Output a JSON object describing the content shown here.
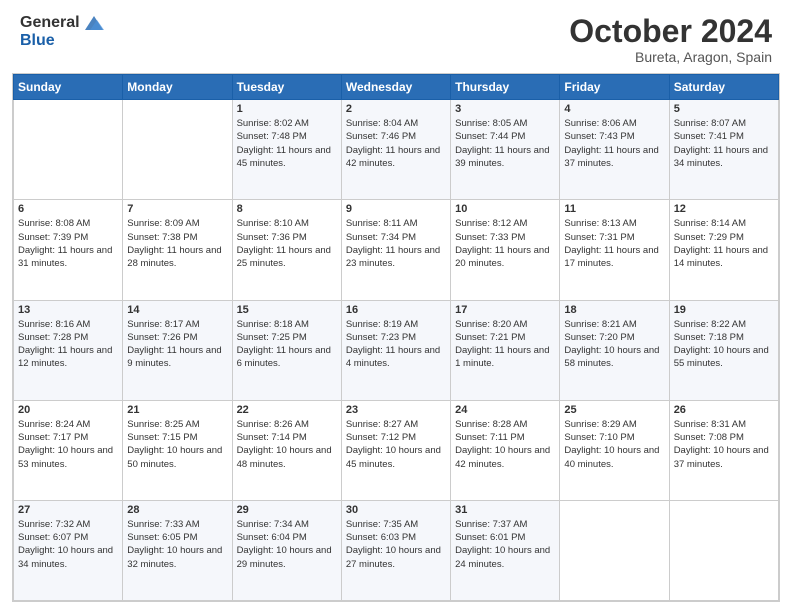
{
  "logo": {
    "general": "General",
    "blue": "Blue"
  },
  "header": {
    "month": "October 2024",
    "location": "Bureta, Aragon, Spain"
  },
  "days_of_week": [
    "Sunday",
    "Monday",
    "Tuesday",
    "Wednesday",
    "Thursday",
    "Friday",
    "Saturday"
  ],
  "weeks": [
    [
      {
        "day": "",
        "info": ""
      },
      {
        "day": "",
        "info": ""
      },
      {
        "day": "1",
        "sunrise": "Sunrise: 8:02 AM",
        "sunset": "Sunset: 7:48 PM",
        "daylight": "Daylight: 11 hours and 45 minutes."
      },
      {
        "day": "2",
        "sunrise": "Sunrise: 8:04 AM",
        "sunset": "Sunset: 7:46 PM",
        "daylight": "Daylight: 11 hours and 42 minutes."
      },
      {
        "day": "3",
        "sunrise": "Sunrise: 8:05 AM",
        "sunset": "Sunset: 7:44 PM",
        "daylight": "Daylight: 11 hours and 39 minutes."
      },
      {
        "day": "4",
        "sunrise": "Sunrise: 8:06 AM",
        "sunset": "Sunset: 7:43 PM",
        "daylight": "Daylight: 11 hours and 37 minutes."
      },
      {
        "day": "5",
        "sunrise": "Sunrise: 8:07 AM",
        "sunset": "Sunset: 7:41 PM",
        "daylight": "Daylight: 11 hours and 34 minutes."
      }
    ],
    [
      {
        "day": "6",
        "sunrise": "Sunrise: 8:08 AM",
        "sunset": "Sunset: 7:39 PM",
        "daylight": "Daylight: 11 hours and 31 minutes."
      },
      {
        "day": "7",
        "sunrise": "Sunrise: 8:09 AM",
        "sunset": "Sunset: 7:38 PM",
        "daylight": "Daylight: 11 hours and 28 minutes."
      },
      {
        "day": "8",
        "sunrise": "Sunrise: 8:10 AM",
        "sunset": "Sunset: 7:36 PM",
        "daylight": "Daylight: 11 hours and 25 minutes."
      },
      {
        "day": "9",
        "sunrise": "Sunrise: 8:11 AM",
        "sunset": "Sunset: 7:34 PM",
        "daylight": "Daylight: 11 hours and 23 minutes."
      },
      {
        "day": "10",
        "sunrise": "Sunrise: 8:12 AM",
        "sunset": "Sunset: 7:33 PM",
        "daylight": "Daylight: 11 hours and 20 minutes."
      },
      {
        "day": "11",
        "sunrise": "Sunrise: 8:13 AM",
        "sunset": "Sunset: 7:31 PM",
        "daylight": "Daylight: 11 hours and 17 minutes."
      },
      {
        "day": "12",
        "sunrise": "Sunrise: 8:14 AM",
        "sunset": "Sunset: 7:29 PM",
        "daylight": "Daylight: 11 hours and 14 minutes."
      }
    ],
    [
      {
        "day": "13",
        "sunrise": "Sunrise: 8:16 AM",
        "sunset": "Sunset: 7:28 PM",
        "daylight": "Daylight: 11 hours and 12 minutes."
      },
      {
        "day": "14",
        "sunrise": "Sunrise: 8:17 AM",
        "sunset": "Sunset: 7:26 PM",
        "daylight": "Daylight: 11 hours and 9 minutes."
      },
      {
        "day": "15",
        "sunrise": "Sunrise: 8:18 AM",
        "sunset": "Sunset: 7:25 PM",
        "daylight": "Daylight: 11 hours and 6 minutes."
      },
      {
        "day": "16",
        "sunrise": "Sunrise: 8:19 AM",
        "sunset": "Sunset: 7:23 PM",
        "daylight": "Daylight: 11 hours and 4 minutes."
      },
      {
        "day": "17",
        "sunrise": "Sunrise: 8:20 AM",
        "sunset": "Sunset: 7:21 PM",
        "daylight": "Daylight: 11 hours and 1 minute."
      },
      {
        "day": "18",
        "sunrise": "Sunrise: 8:21 AM",
        "sunset": "Sunset: 7:20 PM",
        "daylight": "Daylight: 10 hours and 58 minutes."
      },
      {
        "day": "19",
        "sunrise": "Sunrise: 8:22 AM",
        "sunset": "Sunset: 7:18 PM",
        "daylight": "Daylight: 10 hours and 55 minutes."
      }
    ],
    [
      {
        "day": "20",
        "sunrise": "Sunrise: 8:24 AM",
        "sunset": "Sunset: 7:17 PM",
        "daylight": "Daylight: 10 hours and 53 minutes."
      },
      {
        "day": "21",
        "sunrise": "Sunrise: 8:25 AM",
        "sunset": "Sunset: 7:15 PM",
        "daylight": "Daylight: 10 hours and 50 minutes."
      },
      {
        "day": "22",
        "sunrise": "Sunrise: 8:26 AM",
        "sunset": "Sunset: 7:14 PM",
        "daylight": "Daylight: 10 hours and 48 minutes."
      },
      {
        "day": "23",
        "sunrise": "Sunrise: 8:27 AM",
        "sunset": "Sunset: 7:12 PM",
        "daylight": "Daylight: 10 hours and 45 minutes."
      },
      {
        "day": "24",
        "sunrise": "Sunrise: 8:28 AM",
        "sunset": "Sunset: 7:11 PM",
        "daylight": "Daylight: 10 hours and 42 minutes."
      },
      {
        "day": "25",
        "sunrise": "Sunrise: 8:29 AM",
        "sunset": "Sunset: 7:10 PM",
        "daylight": "Daylight: 10 hours and 40 minutes."
      },
      {
        "day": "26",
        "sunrise": "Sunrise: 8:31 AM",
        "sunset": "Sunset: 7:08 PM",
        "daylight": "Daylight: 10 hours and 37 minutes."
      }
    ],
    [
      {
        "day": "27",
        "sunrise": "Sunrise: 7:32 AM",
        "sunset": "Sunset: 6:07 PM",
        "daylight": "Daylight: 10 hours and 34 minutes."
      },
      {
        "day": "28",
        "sunrise": "Sunrise: 7:33 AM",
        "sunset": "Sunset: 6:05 PM",
        "daylight": "Daylight: 10 hours and 32 minutes."
      },
      {
        "day": "29",
        "sunrise": "Sunrise: 7:34 AM",
        "sunset": "Sunset: 6:04 PM",
        "daylight": "Daylight: 10 hours and 29 minutes."
      },
      {
        "day": "30",
        "sunrise": "Sunrise: 7:35 AM",
        "sunset": "Sunset: 6:03 PM",
        "daylight": "Daylight: 10 hours and 27 minutes."
      },
      {
        "day": "31",
        "sunrise": "Sunrise: 7:37 AM",
        "sunset": "Sunset: 6:01 PM",
        "daylight": "Daylight: 10 hours and 24 minutes."
      },
      {
        "day": "",
        "info": ""
      },
      {
        "day": "",
        "info": ""
      }
    ]
  ]
}
